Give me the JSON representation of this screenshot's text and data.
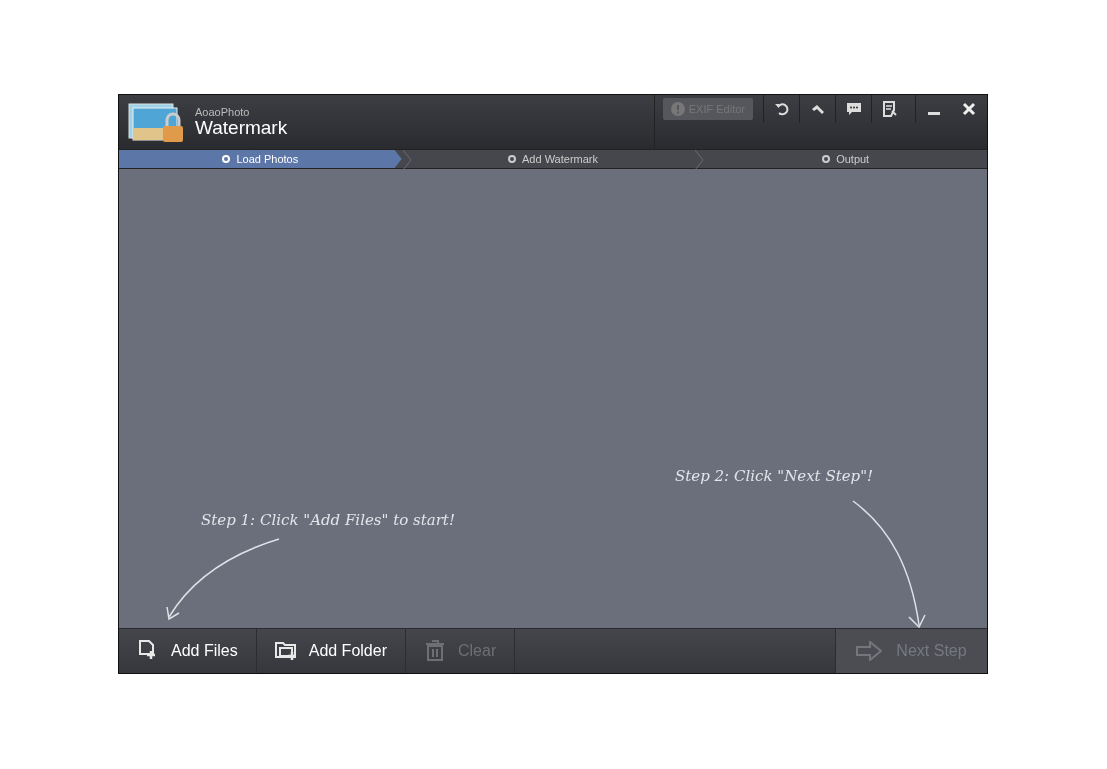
{
  "window": {
    "brand": "AoaoPhoto",
    "title": "Watermark"
  },
  "exif_button": {
    "label": "EXIF Editor",
    "disabled": true
  },
  "steps": [
    {
      "label": "Load Photos",
      "selected": true
    },
    {
      "label": "Add Watermark",
      "selected": false
    },
    {
      "label": "Output",
      "selected": false
    }
  ],
  "hints": [
    {
      "text": "Step 1: Click \"Add Files\" to start!"
    },
    {
      "text": "Step 2: Click \"Next Step\"!"
    }
  ],
  "toolbar": [
    {
      "label": "Add Files",
      "kind": "file",
      "disabled": false
    },
    {
      "label": "Add Folder",
      "kind": "folder",
      "disabled": false
    },
    {
      "label": "Clear",
      "kind": "trash",
      "disabled": true
    }
  ],
  "next_button": {
    "label": "Next Step",
    "disabled": true
  }
}
